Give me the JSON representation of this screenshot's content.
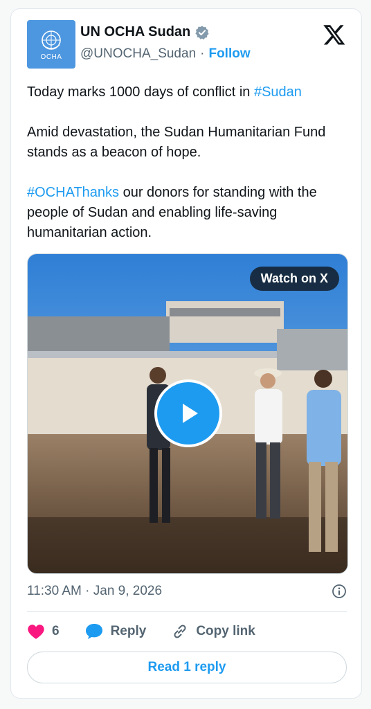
{
  "account": {
    "display_name": "UN OCHA Sudan",
    "handle": "@UNOCHA_Sudan",
    "separator": "·",
    "follow_label": "Follow",
    "avatar_text": "OCHA"
  },
  "tweet": {
    "line1_text": "Today marks 1000 days of conflict in ",
    "line1_hashtag": "#Sudan",
    "paragraph2": "Amid devastation, the Sudan Humanitarian Fund stands as a beacon of hope.",
    "p3_hashtag": "#OCHAThanks",
    "p3_text": " our donors for standing with the people of Sudan and enabling life-saving humanitarian action."
  },
  "media": {
    "watch_label": "Watch on X",
    "icon": "play-icon"
  },
  "meta": {
    "timestamp": "11:30 AM · Jan 9, 2026",
    "info_icon": "info-icon"
  },
  "actions": {
    "like_count": "6",
    "reply_label": "Reply",
    "copy_link_label": "Copy link"
  },
  "footer": {
    "read_reply_label": "Read 1 reply"
  },
  "colors": {
    "accent": "#1d9bf0",
    "like": "#f91880",
    "text": "#0f1419",
    "muted": "#536471"
  }
}
